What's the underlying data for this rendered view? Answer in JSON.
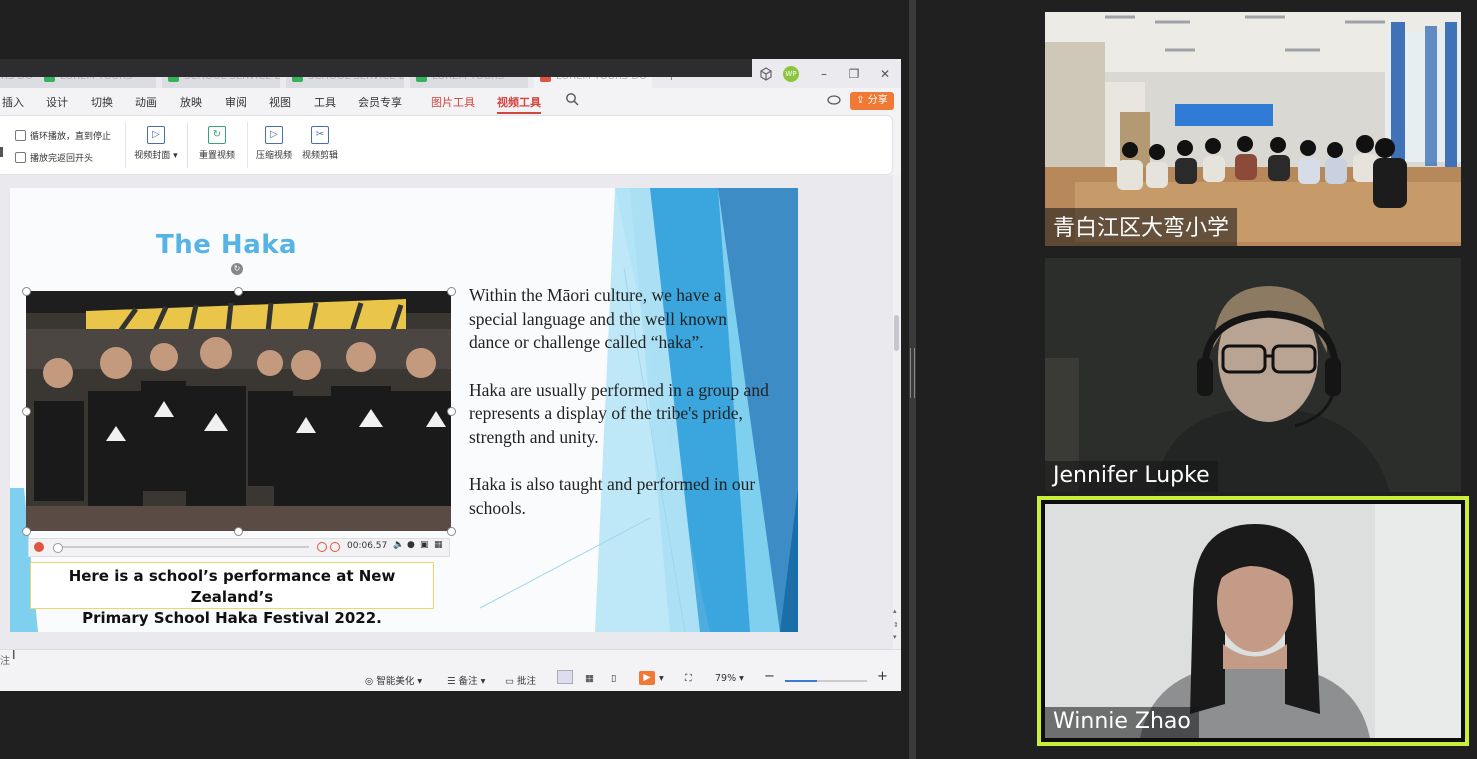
{
  "wps": {
    "doc_tabs": [
      "LOREM YOURS DO",
      "LOREM YOURS",
      "SCHOOL SERVICE DO",
      "SCHOOL SERVICE DO",
      "LOREM YOURS"
    ],
    "avatar_initials": "WP",
    "menus": [
      "插入",
      "设计",
      "切换",
      "动画",
      "放映",
      "审阅",
      "视图",
      "工具",
      "会员专享",
      "图片工具",
      "视频工具"
    ],
    "share_label": "分享",
    "ribbon": {
      "loop_label": "循环播放，直到停止",
      "rewind_label": "播放完返回开头",
      "cover_label": "视频封面",
      "reset_label": "重置视频",
      "compress_label": "压缩视频",
      "edit_label": "视频剪辑"
    },
    "slide": {
      "title": "The Haka",
      "paragraphs": [
        "Within the Māori culture, we have a special language and the well known dance or challenge called “haka”.",
        "Haka are usually performed in a group and represents a display of the tribe's pride, strength and unity.",
        "Haka is also taught and performed in our schools."
      ],
      "video_time": "00:06.57",
      "caption_line1": "Here is a school’s performance at New Zealand’s",
      "caption_line2": "Primary School Haka Festival 2022."
    },
    "notes_label": "注",
    "status": {
      "beautify": "智能美化",
      "notes": "备注",
      "comment": "批注",
      "zoom": "79%"
    }
  },
  "participants": [
    {
      "name": "青白江区大弯小学"
    },
    {
      "name": "Jennifer Lupke"
    },
    {
      "name": "Winnie Zhao"
    }
  ],
  "colors": {
    "active_speaker_border": "#c9ef38",
    "slide_title": "#55b4e4",
    "accent_red": "#d2463e"
  }
}
